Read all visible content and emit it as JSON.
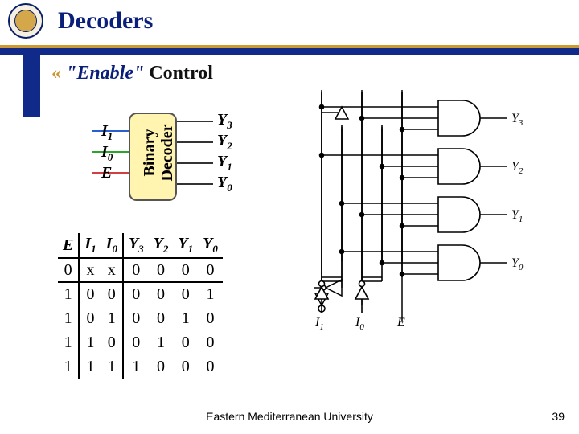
{
  "slide": {
    "title": "Decoders",
    "subtitle_star": "«",
    "subtitle_enable": "\"Enable\"",
    "subtitle_control": " Control",
    "block_label_l1": "Binary",
    "block_label_l2": "Decoder",
    "inputs": {
      "i1": "I",
      "i1_sub": "1",
      "i0": "I",
      "i0_sub": "0",
      "e": "E"
    },
    "outputs": {
      "y3": "Y",
      "y3_sub": "3",
      "y2": "Y",
      "y2_sub": "2",
      "y1": "Y",
      "y1_sub": "1",
      "y0": "Y",
      "y0_sub": "0"
    }
  },
  "footer": {
    "org": "Eastern Mediterranean University",
    "page": "39"
  },
  "circuit_labels": {
    "I1": "I",
    "I1s": "1",
    "I0": "I",
    "I0s": "0",
    "E": "E",
    "Y0": "Y",
    "Y0s": "0",
    "Y1": "Y",
    "Y1s": "1",
    "Y2": "Y",
    "Y2s": "2",
    "Y3": "Y",
    "Y3s": "3"
  },
  "chart_data": {
    "type": "table",
    "title": "2-to-4 decoder with enable truth table",
    "columns": [
      "E",
      "I1",
      "I0",
      "Y3",
      "Y2",
      "Y1",
      "Y0"
    ],
    "rows": [
      [
        "0",
        "x",
        "x",
        "0",
        "0",
        "0",
        "0"
      ],
      [
        "1",
        "0",
        "0",
        "0",
        "0",
        "0",
        "1"
      ],
      [
        "1",
        "0",
        "1",
        "0",
        "0",
        "1",
        "0"
      ],
      [
        "1",
        "1",
        "0",
        "0",
        "1",
        "0",
        "0"
      ],
      [
        "1",
        "1",
        "1",
        "1",
        "0",
        "0",
        "0"
      ]
    ]
  }
}
